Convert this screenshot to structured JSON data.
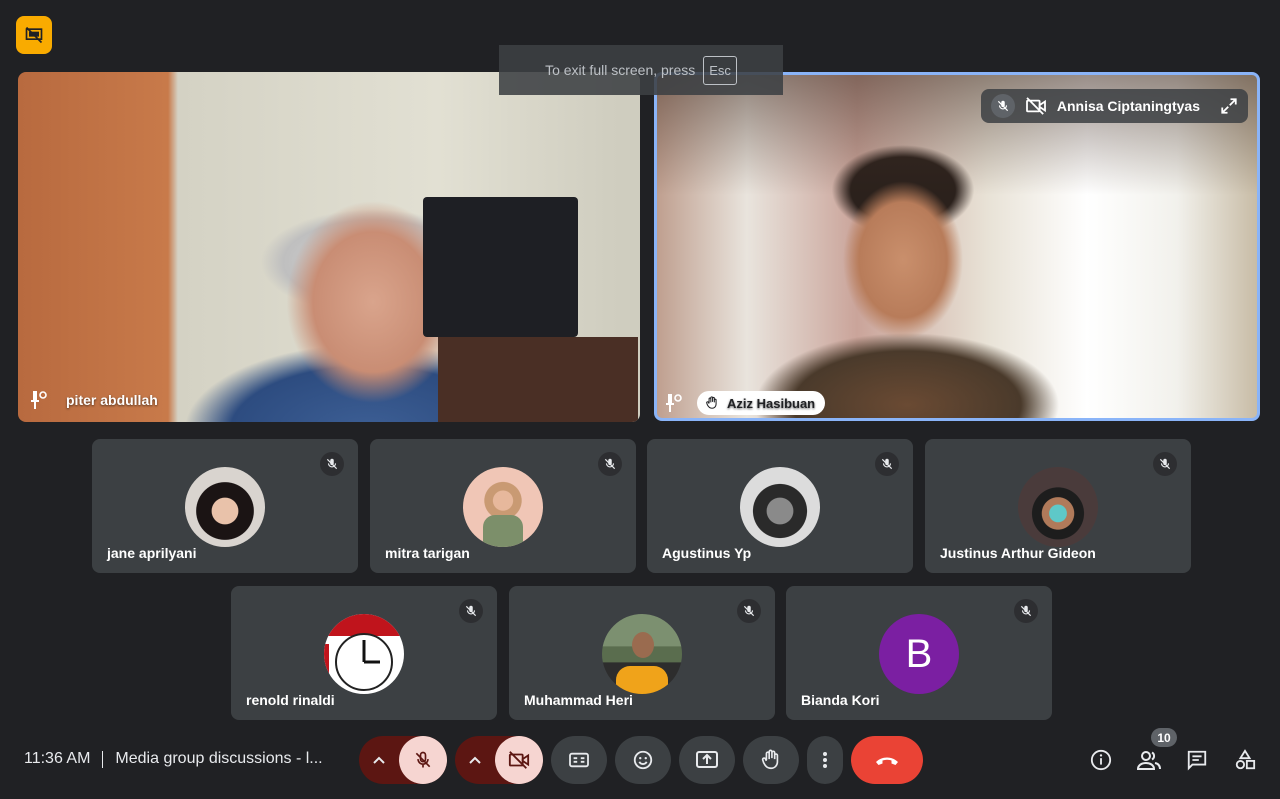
{
  "toast": {
    "text": "To exit full screen, press",
    "key": "Esc"
  },
  "main_tiles": [
    {
      "name": "piter abdullah",
      "pinned": true
    },
    {
      "name": "Aziz Hasibuan",
      "pinned": true,
      "hand_raised": true,
      "overlay_name": "Annisa Ciptaningtyas"
    }
  ],
  "participants": [
    {
      "name": "jane aprilyani",
      "muted": true
    },
    {
      "name": "mitra tarigan",
      "muted": true
    },
    {
      "name": "Agustinus Yp",
      "muted": true
    },
    {
      "name": "Justinus Arthur Gideon",
      "muted": true
    },
    {
      "name": "renold rinaldi",
      "muted": true
    },
    {
      "name": "Muhammad Heri",
      "muted": true
    },
    {
      "name": "Bianda Kori",
      "muted": true,
      "initial": "B",
      "avatar_color": "#7b1fa2"
    }
  ],
  "bottom_bar": {
    "time": "11:36 AM",
    "meeting_title": "Media group discussions - l...",
    "people_count": "10"
  },
  "colors": {
    "background": "#202124",
    "tile": "#3c4043",
    "end_call": "#ea4335",
    "active_border": "#8ab4f8",
    "badge": "#f9ab00"
  }
}
